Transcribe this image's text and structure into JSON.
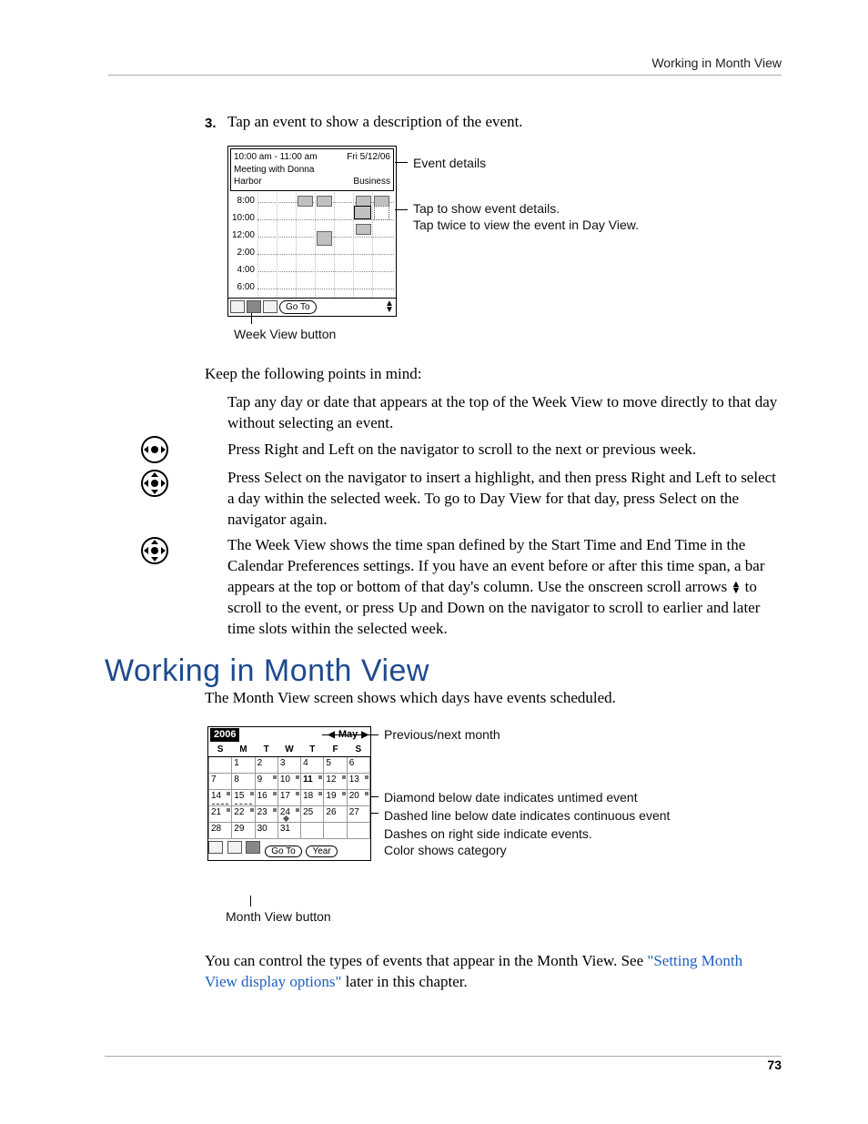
{
  "header": {
    "text": "Working in Month View"
  },
  "step3": {
    "num": "3.",
    "text": "Tap an event to show a description of the event."
  },
  "weekview": {
    "time": "10:00 am - 11:00 am",
    "date": "Fri 5/12/06",
    "subject": "Meeting with Donna",
    "location": "Harbor",
    "category": "Business",
    "hours": [
      "8:00",
      "10:00",
      "12:00",
      "2:00",
      "4:00",
      "6:00"
    ],
    "goto": "Go To",
    "btn_label": "Week View button"
  },
  "week_ann": {
    "details": "Event details",
    "tap1": "Tap to show event details.",
    "tap2": "Tap twice to view the event in Day View."
  },
  "keep_intro": "Keep the following points in mind:",
  "tips": {
    "t1": "Tap any day or date that appears at the top of the Week View to move directly to that day without selecting an event.",
    "t2": "Press Right and Left on the navigator to scroll to the next or previous week.",
    "t3": "Press Select on the navigator to insert a highlight, and then press Right and Left to select a day within the selected week. To go to Day View for that day, press Select on the navigator again.",
    "t4a": "The Week View shows the time span defined by the Start Time and End Time in the Calendar Preferences settings. If you have an event before or after this time span, a bar appears at the top or bottom of that day's column. Use the onscreen scroll arrows ",
    "t4b": " to scroll to the event, or press Up and Down on the navigator to scroll to earlier and later time slots within the selected week."
  },
  "section": {
    "title": "Working in Month View"
  },
  "month_intro": "The Month View screen shows which days have events scheduled.",
  "monthview": {
    "year": "2006",
    "month": "May",
    "dow": [
      "S",
      "M",
      "T",
      "W",
      "T",
      "F",
      "S"
    ],
    "weeks": [
      [
        "",
        "1",
        "2",
        "3",
        "4",
        "5",
        "6"
      ],
      [
        "7",
        "8",
        "9",
        "10",
        "11",
        "12",
        "13"
      ],
      [
        "14",
        "15",
        "16",
        "17",
        "18",
        "19",
        "20"
      ],
      [
        "21",
        "22",
        "23",
        "24",
        "25",
        "26",
        "27"
      ],
      [
        "28",
        "29",
        "30",
        "31",
        "",
        "",
        ""
      ]
    ],
    "goto": "Go To",
    "yearbtn": "Year",
    "btn_label": "Month View button"
  },
  "month_ann": {
    "prevnext": "Previous/next month",
    "diamond": "Diamond below date indicates untimed event",
    "dashed": "Dashed line below date indicates continuous event",
    "dashes": "Dashes on right side indicate events.",
    "color": "Color shows category"
  },
  "closing": {
    "a": "You can control the types of events that appear in the Month View. See ",
    "link": "\"Setting Month View display options\"",
    "b": " later in this chapter."
  },
  "page": "73"
}
